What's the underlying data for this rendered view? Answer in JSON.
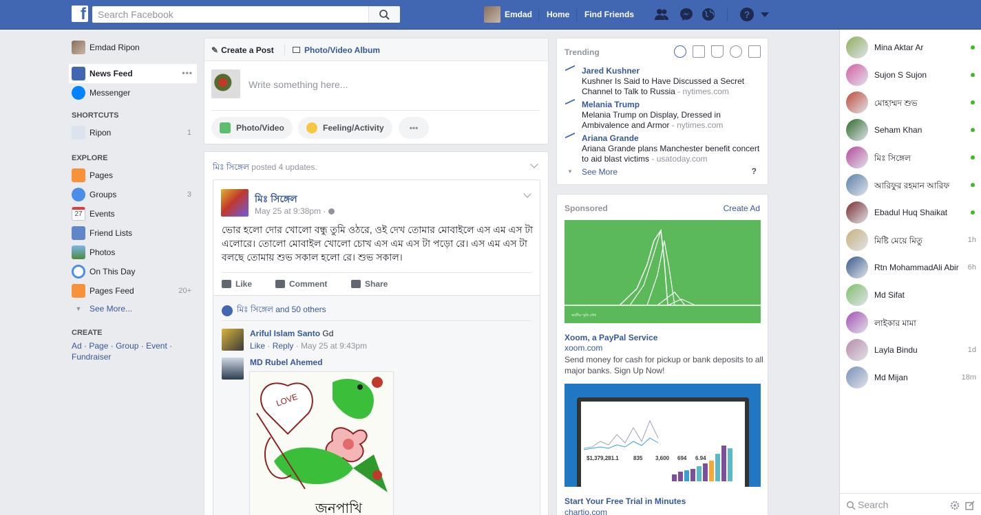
{
  "topbar": {
    "logo": "f",
    "search_placeholder": "Search Facebook",
    "user_name": "Emdad",
    "home": "Home",
    "find_friends": "Find Friends",
    "icons": [
      "friend-requests-icon",
      "messenger-icon",
      "notifications-globe-icon",
      "help-icon",
      "account-menu-chevron-icon"
    ]
  },
  "left_nav": {
    "profile_name": "Emdad Ripon",
    "news_feed": "News Feed",
    "messenger": "Messenger",
    "shortcuts_title": "SHORTCUTS",
    "shortcuts": [
      {
        "label": "Ripon",
        "count": "1"
      }
    ],
    "explore_title": "EXPLORE",
    "explore": [
      {
        "label": "Pages",
        "count": ""
      },
      {
        "label": "Groups",
        "count": "3"
      },
      {
        "label": "Events",
        "count": ""
      },
      {
        "label": "Friend Lists",
        "count": ""
      },
      {
        "label": "Photos",
        "count": ""
      },
      {
        "label": "On This Day",
        "count": ""
      },
      {
        "label": "Pages Feed",
        "count": "20+"
      }
    ],
    "events_day": "27",
    "see_more": "See More...",
    "create_title": "CREATE",
    "create_links": [
      "Ad",
      "Page",
      "Group",
      "Event",
      "Fundraiser"
    ]
  },
  "composer": {
    "tab_create_post": "Create a Post",
    "tab_photo_album": "Photo/Video Album",
    "placeholder": "Write something here...",
    "btn_photo": "Photo/Video",
    "btn_feeling": "Feeling/Activity",
    "btn_more": "•••"
  },
  "feed": {
    "header_name": "মিঃ সিঙ্গেল",
    "header_rest": "posted 4 updates.",
    "post": {
      "author": "মিঃ সিঙ্গেল",
      "time": "May 25 at 9:38pm · ",
      "text": "ভোর হলো দোর খোলো বন্ধু তুমি ওঠরে, ওই দেখ তোমার মোবাইলে এস এম এস টা এলোরে। তোলো মোবাইল খোলো চোখ এস এম এস টা পড়ো রে। এস এম এস টা বলছে তোমায় শুভ সকাল হলো রে। শুভ সকাল।",
      "like": "Like",
      "comment": "Comment",
      "share": "Share",
      "likes_text": "মিঃ সিঙ্গেল and 50 others",
      "comments": [
        {
          "author": "Ariful Islam Santo",
          "text": "Gd",
          "like": "Like",
          "reply": "Reply",
          "time": "May 25 at 9:43pm"
        },
        {
          "author": "MD Rubel Ahemed",
          "text": ""
        }
      ],
      "photo_caption": "জনপাখি",
      "photo_heart_text": "LOVE"
    }
  },
  "trending": {
    "title": "Trending",
    "items": [
      {
        "name": "Jared Kushner",
        "desc": "Kushner Is Said to Have Discussed a Secret Channel to Talk to Russia",
        "source": " - nytimes.com"
      },
      {
        "name": "Melania Trump",
        "desc": "Melania Trump on Display, Dressed in Ambivalence and Armor",
        "source": " - nytimes.com"
      },
      {
        "name": "Ariana Grande",
        "desc": "Ariana Grande plans Manchester benefit concert to aid blast victims",
        "source": " - usatoday.com"
      }
    ],
    "see_more": "See More",
    "help": "?"
  },
  "sponsored": {
    "title": "Sponsored",
    "create_ad": "Create Ad",
    "ad1_caption": "জাতীয় স্মৃতি সৌধ",
    "ad1_title": "Xoom, a PayPal Service",
    "ad1_url": "xoom.com",
    "ad1_desc": "Send money for cash for pickup or bank deposits to all major banks. Sign Up Now!",
    "ad2_stats": [
      "$1,379,281.1",
      "835",
      "3,600",
      "694",
      "6.94"
    ],
    "ad2_title": "Start Your Free Trial in Minutes",
    "ad2_url": "chartio.com"
  },
  "chat": {
    "contacts": [
      {
        "name": "Mina Aktar Ar",
        "status": "online",
        "color": "#8fae5a"
      },
      {
        "name": "Sujon S Sujon",
        "status": "online",
        "color": "#d65ba7"
      },
      {
        "name": "মোহাম্মদ শুভ",
        "status": "online",
        "color": "#c04a3a"
      },
      {
        "name": "Seham Khan",
        "status": "online",
        "color": "#2e6b2a"
      },
      {
        "name": "মিঃ সিঙ্গেল",
        "status": "online",
        "color": "#b34a9a"
      },
      {
        "name": "আরিফুর রহমান আরিফ",
        "status": "online",
        "color": "#5a7fa8"
      },
      {
        "name": "Ebadul Huq Shaikat",
        "status": "online",
        "color": "#7a2d2d"
      },
      {
        "name": "মিষ্টি মেয়ে মিতু",
        "status": "1h",
        "color": "#c9b07a"
      },
      {
        "name": "Rtn MohammadAli Abir",
        "status": "6h",
        "color": "#3a5a8a"
      },
      {
        "name": "Md Sifat",
        "status": "",
        "color": "#7fbf6a"
      },
      {
        "name": "লাইকার মামা",
        "status": "",
        "color": "#a64fb3"
      },
      {
        "name": "Layla Bindu",
        "status": "1d",
        "color": "#b88aa8"
      },
      {
        "name": "Md Mijan",
        "status": "18m",
        "color": "#7a8fb8"
      }
    ],
    "search_placeholder": "Search"
  },
  "colors": {
    "brand": "#4267b2",
    "link": "#365899",
    "online": "#42b72a",
    "ad1_bg": "#5cb95a",
    "ad2_bg": "#1f78c1"
  }
}
